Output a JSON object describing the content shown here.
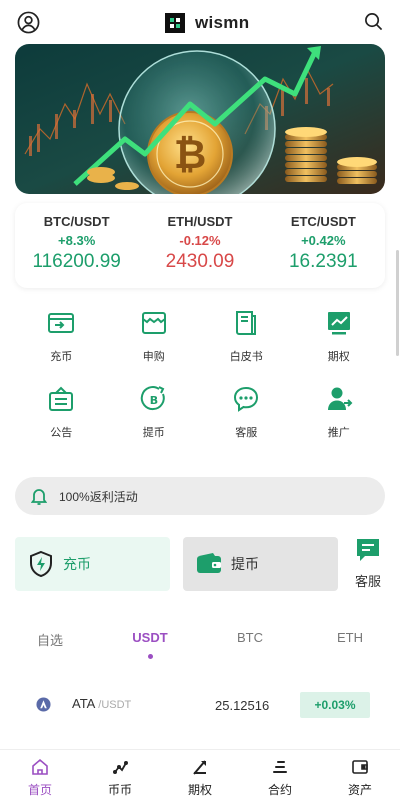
{
  "header": {
    "brand": "wismn",
    "icons": {
      "left": "user-circle-icon",
      "right": "search-icon"
    }
  },
  "colors": {
    "green": "#1d9e6b",
    "red": "#d84848",
    "purple": "#9b4fc2"
  },
  "tickers": [
    {
      "pair": "BTC/USDT",
      "change": "+8.3%",
      "price": "116200.99",
      "direction": "up"
    },
    {
      "pair": "ETH/USDT",
      "change": "-0.12%",
      "price": "2430.09",
      "direction": "down"
    },
    {
      "pair": "ETC/USDT",
      "change": "+0.42%",
      "price": "16.2391",
      "direction": "up"
    }
  ],
  "grid": [
    {
      "label": "充币",
      "icon": "deposit-icon"
    },
    {
      "label": "申购",
      "icon": "subscribe-icon"
    },
    {
      "label": "白皮书",
      "icon": "whitepaper-icon"
    },
    {
      "label": "期权",
      "icon": "options-chart-icon"
    },
    {
      "label": "公告",
      "icon": "announcement-icon"
    },
    {
      "label": "提币",
      "icon": "withdraw-coin-icon"
    },
    {
      "label": "客服",
      "icon": "chat-icon"
    },
    {
      "label": "推广",
      "icon": "promote-user-icon"
    }
  ],
  "notice": {
    "text": "100%返利活动",
    "icon": "bell-icon"
  },
  "actions": {
    "recharge": "充币",
    "withdraw": "提币",
    "service": "客服"
  },
  "tabs": [
    {
      "label": "自选",
      "active": false
    },
    {
      "label": "USDT",
      "active": true
    },
    {
      "label": "BTC",
      "active": false
    },
    {
      "label": "ETH",
      "active": false
    }
  ],
  "market": [
    {
      "symbol": "ATA",
      "quote": "/USDT",
      "price": "25.12516",
      "change": "+0.03%"
    }
  ],
  "nav": [
    {
      "label": "首页",
      "icon": "home-icon",
      "active": true
    },
    {
      "label": "币币",
      "icon": "coin-trade-icon",
      "active": false
    },
    {
      "label": "期权",
      "icon": "options-icon",
      "active": false
    },
    {
      "label": "合约",
      "icon": "contract-icon",
      "active": false
    },
    {
      "label": "资产",
      "icon": "wallet-icon",
      "active": false
    }
  ]
}
